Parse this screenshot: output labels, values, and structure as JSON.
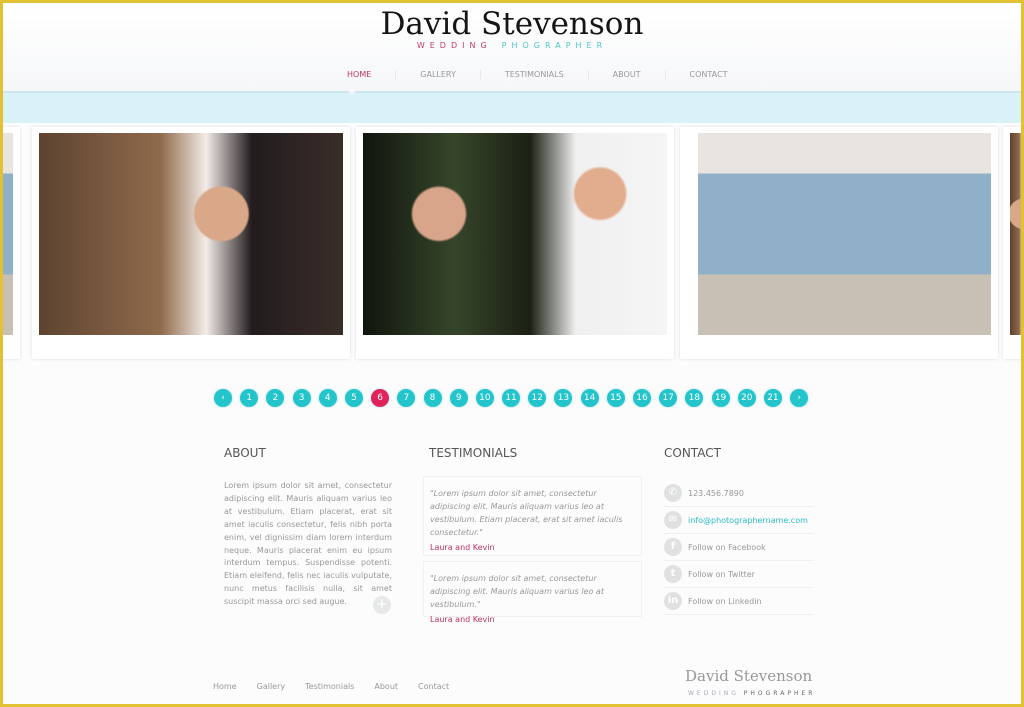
{
  "header": {
    "brand": "David Stevenson",
    "tagline_a": "WEDDING",
    "tagline_b": "PHOGRAPHER",
    "nav": [
      "HOME",
      "GALLERY",
      "TESTIMONIALS",
      "ABOUT",
      "CONTACT"
    ],
    "active_nav": "HOME"
  },
  "gallery": {
    "photos": [
      "bride-and-groom-embrace",
      "couple-at-night-bokeh",
      "bridal-party"
    ]
  },
  "pagination": {
    "prev": "‹",
    "next": "›",
    "pages": [
      "1",
      "2",
      "3",
      "4",
      "5",
      "6",
      "7",
      "8",
      "9",
      "10",
      "11",
      "12",
      "13",
      "14",
      "15",
      "16",
      "17",
      "18",
      "19",
      "20",
      "21"
    ],
    "current": "6",
    "accent": "#24c4cb",
    "active_color": "#e0245a"
  },
  "about": {
    "title": "ABOUT",
    "text": "Lorem ipsum dolor sit amet, consectetur adipiscing elit. Mauris aliquam varius leo at vestibulum. Etiam placerat, erat sit amet iaculis consectetur, felis nibh porta enim, vel dignissim diam lorem interdum neque. Mauris placerat enim eu ipsum interdum tempus. Suspendisse potenti. Etiam eleifend, felis nec iaculis vulputate, nunc metus facilisis nulla, sit amet suscipit massa orci sed augue.",
    "more": "+"
  },
  "testimonials": {
    "title": "TESTIMONIALS",
    "items": [
      {
        "quote": "\"Lorem ipsum dolor sit amet, consectetur adipiscing elit. Mauris aliquam varius leo at vestibulum. Etiam placerat, erat sit amet iaculis consectetur.\"",
        "author": "Laura and Kevin"
      },
      {
        "quote": "\"Lorem ipsum dolor sit amet, consectetur adipiscing elit. Mauris aliquam varius leo at vestibulum.\"",
        "author": "Laura and Kevin"
      }
    ]
  },
  "contact": {
    "title": "CONTACT",
    "items": [
      {
        "icon": "phone-icon",
        "glyph": "✆",
        "text": "123.456.7890"
      },
      {
        "icon": "mail-icon",
        "glyph": "✉",
        "text": "info@photographername.com"
      },
      {
        "icon": "facebook-icon",
        "glyph": "f",
        "text": "Follow on Facebook"
      },
      {
        "icon": "twitter-icon",
        "glyph": "t",
        "text": "Follow on Twitter"
      },
      {
        "icon": "linkedin-icon",
        "glyph": "in",
        "text": "Follow on Linkedin"
      }
    ]
  },
  "footer": {
    "nav": [
      "Home",
      "Gallery",
      "Testimonials",
      "About",
      "Contact"
    ],
    "brand": "David Stevenson",
    "tagline_a": "WEDDING",
    "tagline_b": "PHOGRAPHER"
  }
}
